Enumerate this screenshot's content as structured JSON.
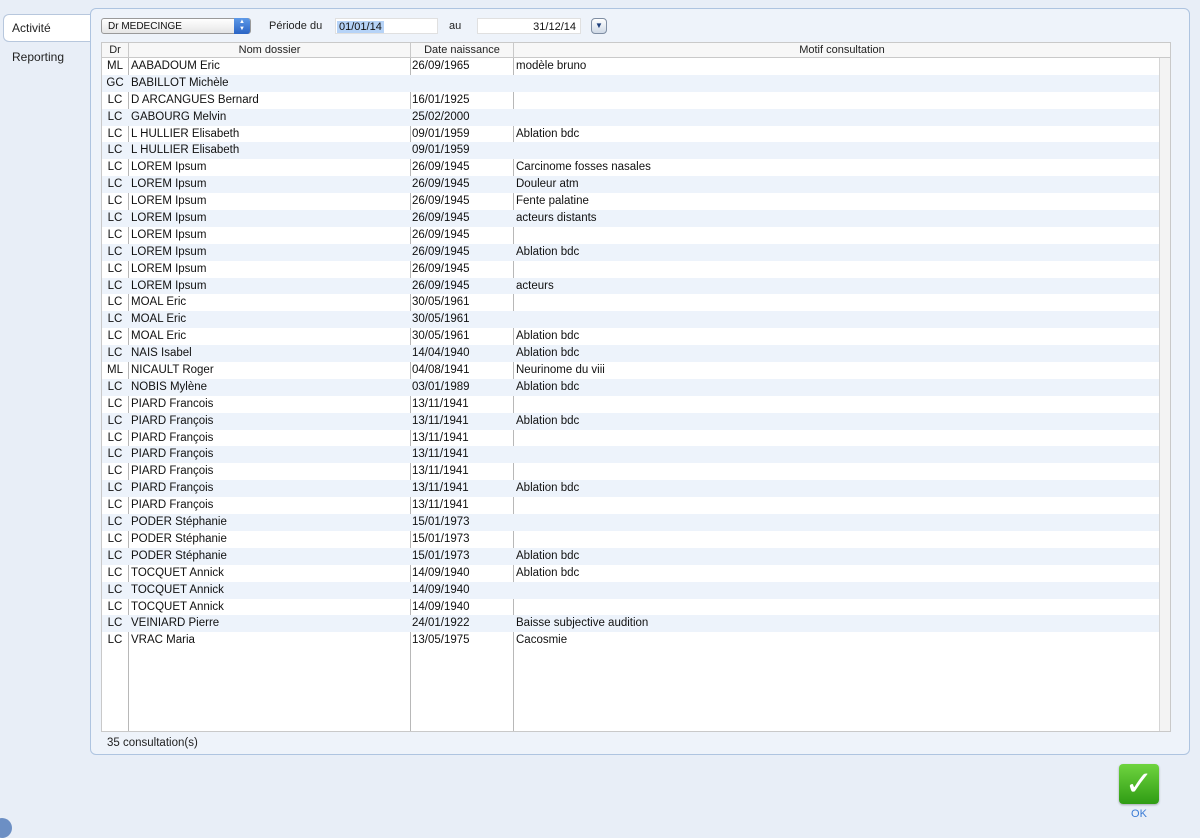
{
  "tabs": [
    {
      "label": "Activité",
      "active": true
    },
    {
      "label": "Reporting",
      "active": false
    }
  ],
  "filters": {
    "doctor": "Dr MEDECINGE",
    "period_label": "Période du",
    "date_from": "01/01/14",
    "to_label": "au",
    "date_to": "31/12/14"
  },
  "table": {
    "headers": {
      "dr": "Dr",
      "nom": "Nom dossier",
      "date": "Date naissance",
      "motif": "Motif consultation"
    },
    "rows": [
      {
        "dr": "ML",
        "nom": "AABADOUM Eric",
        "date": "26/09/1965",
        "motif": "modèle bruno"
      },
      {
        "dr": "GC",
        "nom": "BABILLOT Michèle",
        "date": "",
        "motif": ""
      },
      {
        "dr": "LC",
        "nom": "D ARCANGUES Bernard",
        "date": "16/01/1925",
        "motif": ""
      },
      {
        "dr": "LC",
        "nom": "GABOURG Melvin",
        "date": "25/02/2000",
        "motif": ""
      },
      {
        "dr": "LC",
        "nom": "L HULLIER Elisabeth",
        "date": "09/01/1959",
        "motif": "Ablation bdc"
      },
      {
        "dr": "LC",
        "nom": "L HULLIER Elisabeth",
        "date": "09/01/1959",
        "motif": ""
      },
      {
        "dr": "LC",
        "nom": "LOREM Ipsum",
        "date": "26/09/1945",
        "motif": "Carcinome fosses nasales"
      },
      {
        "dr": "LC",
        "nom": "LOREM Ipsum",
        "date": "26/09/1945",
        "motif": "Douleur atm"
      },
      {
        "dr": "LC",
        "nom": "LOREM Ipsum",
        "date": "26/09/1945",
        "motif": "Fente palatine"
      },
      {
        "dr": "LC",
        "nom": "LOREM Ipsum",
        "date": "26/09/1945",
        "motif": "acteurs distants"
      },
      {
        "dr": "LC",
        "nom": "LOREM Ipsum",
        "date": "26/09/1945",
        "motif": ""
      },
      {
        "dr": "LC",
        "nom": "LOREM Ipsum",
        "date": "26/09/1945",
        "motif": "Ablation bdc"
      },
      {
        "dr": "LC",
        "nom": "LOREM Ipsum",
        "date": "26/09/1945",
        "motif": ""
      },
      {
        "dr": "LC",
        "nom": "LOREM Ipsum",
        "date": "26/09/1945",
        "motif": "acteurs"
      },
      {
        "dr": "LC",
        "nom": "MOAL Eric",
        "date": "30/05/1961",
        "motif": ""
      },
      {
        "dr": "LC",
        "nom": "MOAL Eric",
        "date": "30/05/1961",
        "motif": ""
      },
      {
        "dr": "LC",
        "nom": "MOAL Eric",
        "date": "30/05/1961",
        "motif": "Ablation bdc"
      },
      {
        "dr": "LC",
        "nom": "NAIS Isabel",
        "date": "14/04/1940",
        "motif": "Ablation bdc"
      },
      {
        "dr": "ML",
        "nom": "NICAULT Roger",
        "date": "04/08/1941",
        "motif": "Neurinome du viii"
      },
      {
        "dr": "LC",
        "nom": "NOBIS Mylène",
        "date": "03/01/1989",
        "motif": "Ablation bdc"
      },
      {
        "dr": "LC",
        "nom": "PIARD Francois",
        "date": "13/11/1941",
        "motif": ""
      },
      {
        "dr": "LC",
        "nom": "PIARD François",
        "date": "13/11/1941",
        "motif": "Ablation bdc"
      },
      {
        "dr": "LC",
        "nom": "PIARD François",
        "date": "13/11/1941",
        "motif": ""
      },
      {
        "dr": "LC",
        "nom": "PIARD François",
        "date": "13/11/1941",
        "motif": ""
      },
      {
        "dr": "LC",
        "nom": "PIARD François",
        "date": "13/11/1941",
        "motif": ""
      },
      {
        "dr": "LC",
        "nom": "PIARD François",
        "date": "13/11/1941",
        "motif": "Ablation bdc"
      },
      {
        "dr": "LC",
        "nom": "PIARD François",
        "date": "13/11/1941",
        "motif": ""
      },
      {
        "dr": "LC",
        "nom": "PODER Stéphanie",
        "date": "15/01/1973",
        "motif": ""
      },
      {
        "dr": "LC",
        "nom": "PODER Stéphanie",
        "date": "15/01/1973",
        "motif": ""
      },
      {
        "dr": "LC",
        "nom": "PODER Stéphanie",
        "date": "15/01/1973",
        "motif": "Ablation bdc"
      },
      {
        "dr": "LC",
        "nom": "TOCQUET Annick",
        "date": "14/09/1940",
        "motif": "Ablation bdc"
      },
      {
        "dr": "LC",
        "nom": "TOCQUET Annick",
        "date": "14/09/1940",
        "motif": ""
      },
      {
        "dr": "LC",
        "nom": "TOCQUET Annick",
        "date": "14/09/1940",
        "motif": ""
      },
      {
        "dr": "LC",
        "nom": "VEINIARD Pierre",
        "date": "24/01/1922",
        "motif": "Baisse subjective audition"
      },
      {
        "dr": "LC",
        "nom": "VRAC Maria",
        "date": "13/05/1975",
        "motif": "Cacosmie"
      }
    ]
  },
  "footer": {
    "count_text": "35 consultation(s)"
  },
  "ok_button": {
    "label": "OK",
    "icon": "checkmark-icon",
    "color": "#3fb523"
  }
}
